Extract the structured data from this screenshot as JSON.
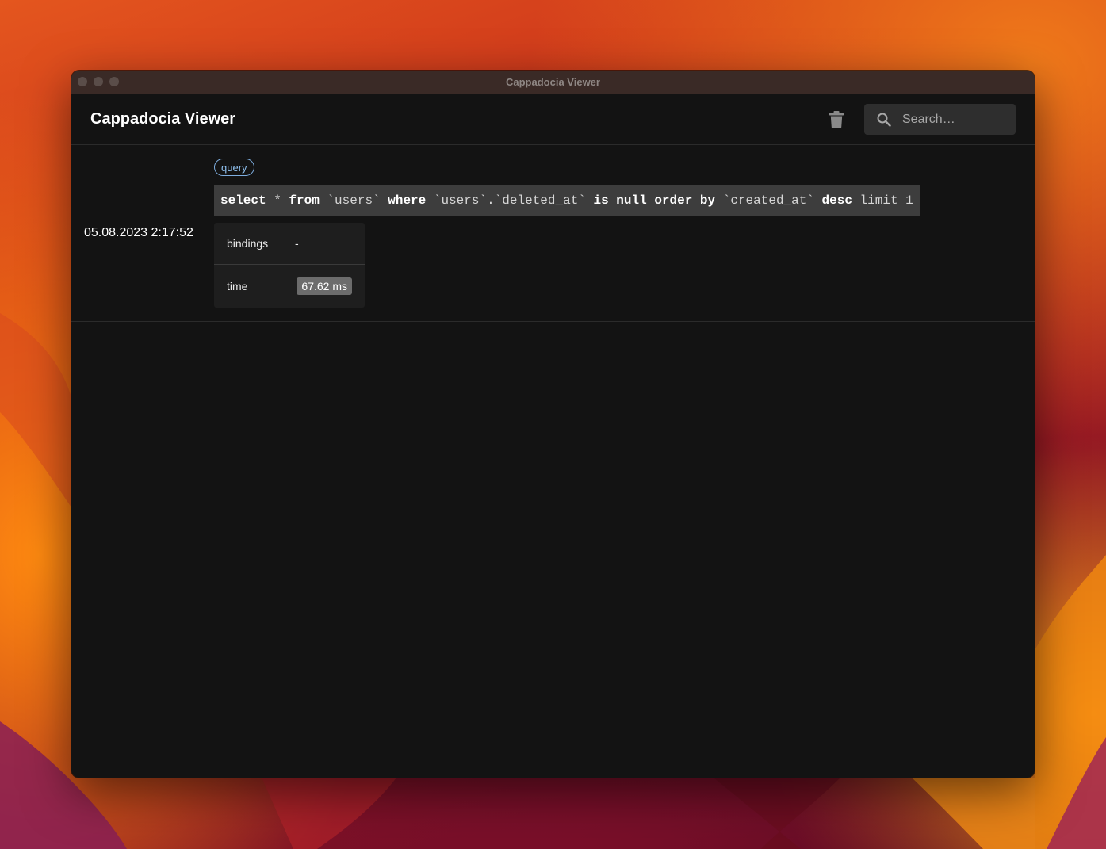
{
  "window": {
    "titlebar_title": "Cappadocia Viewer"
  },
  "appbar": {
    "title": "Cappadocia Viewer",
    "trash_icon": "trash-icon",
    "search": {
      "icon": "search-icon",
      "placeholder": "Search…",
      "value": ""
    }
  },
  "entries": [
    {
      "timestamp": "05.08.2023 2:17:52",
      "badge": "query",
      "sql_tokens": [
        {
          "text": "select",
          "kw": true
        },
        {
          "text": " * ",
          "kw": false
        },
        {
          "text": "from",
          "kw": true
        },
        {
          "text": " `users` ",
          "kw": false
        },
        {
          "text": "where",
          "kw": true
        },
        {
          "text": " `users`.`deleted_at` ",
          "kw": false
        },
        {
          "text": "is null order by",
          "kw": true
        },
        {
          "text": " `created_at` ",
          "kw": false
        },
        {
          "text": "desc",
          "kw": true
        },
        {
          "text": " limit 1",
          "kw": false
        }
      ],
      "bindings_label": "bindings",
      "bindings_value": "-",
      "time_label": "time",
      "time_value": "67.62 ms"
    }
  ],
  "colors": {
    "accent_badge": "#8fc0ee",
    "window_bg": "#131313",
    "titlebar_bg": "#3a2a26"
  }
}
